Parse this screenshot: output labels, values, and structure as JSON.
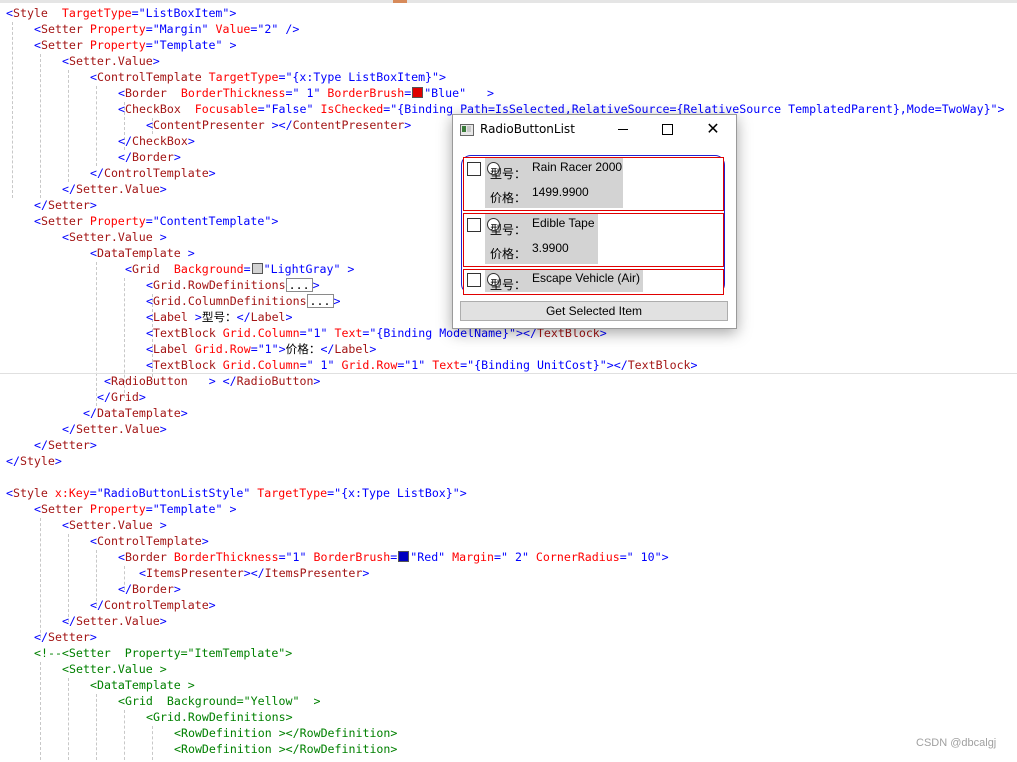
{
  "editor": {
    "lines": [
      [
        {
          "c": "punct",
          "t": "<"
        },
        {
          "c": "tag",
          "t": "Style"
        },
        {
          "c": "attr",
          "t": "  TargetType"
        },
        {
          "c": "punct",
          "t": "="
        },
        {
          "c": "str",
          "t": "\"ListBoxItem\""
        },
        {
          "c": "punct",
          "t": ">"
        }
      ],
      [
        {
          "c": "punct",
          "t": "<"
        },
        {
          "c": "tag",
          "t": "Setter"
        },
        {
          "c": "attr",
          "t": " Property"
        },
        {
          "c": "punct",
          "t": "="
        },
        {
          "c": "str",
          "t": "\"Margin\""
        },
        {
          "c": "attr",
          "t": " Value"
        },
        {
          "c": "punct",
          "t": "="
        },
        {
          "c": "str",
          "t": "\"2\""
        },
        {
          "c": "punct",
          "t": " />"
        }
      ],
      [
        {
          "c": "punct",
          "t": "<"
        },
        {
          "c": "tag",
          "t": "Setter"
        },
        {
          "c": "attr",
          "t": " Property"
        },
        {
          "c": "punct",
          "t": "="
        },
        {
          "c": "str",
          "t": "\"Template\""
        },
        {
          "c": "punct",
          "t": " >"
        }
      ],
      [
        {
          "c": "punct",
          "t": "<"
        },
        {
          "c": "tag",
          "t": "Setter.Value"
        },
        {
          "c": "punct",
          "t": ">"
        }
      ],
      [
        {
          "c": "punct",
          "t": "<"
        },
        {
          "c": "tag",
          "t": "ControlTemplate"
        },
        {
          "c": "attr",
          "t": " TargetType"
        },
        {
          "c": "punct",
          "t": "="
        },
        {
          "c": "str",
          "t": "\"{x:Type ListBoxItem}\""
        },
        {
          "c": "punct",
          "t": ">"
        }
      ],
      [
        {
          "c": "punct",
          "t": "<"
        },
        {
          "c": "tag",
          "t": "Border"
        },
        {
          "c": "attr",
          "t": "  BorderThickness"
        },
        {
          "c": "punct",
          "t": "="
        },
        {
          "c": "str",
          "t": "\" 1\""
        },
        {
          "c": "attr",
          "t": " BorderBrush"
        },
        {
          "c": "punct",
          "t": "="
        },
        {
          "c": "swatch",
          "t": "#e00000"
        },
        {
          "c": "str",
          "t": "\"Blue\""
        },
        {
          "c": "punct",
          "t": "   >"
        }
      ],
      [
        {
          "c": "punct",
          "t": "<"
        },
        {
          "c": "tag",
          "t": "CheckBox"
        },
        {
          "c": "attr",
          "t": "  Focusable"
        },
        {
          "c": "punct",
          "t": "="
        },
        {
          "c": "str",
          "t": "\"False\""
        },
        {
          "c": "attr",
          "t": " IsChecked"
        },
        {
          "c": "punct",
          "t": "="
        },
        {
          "c": "str",
          "t": "\"{Binding Path=IsSelected,RelativeSource={RelativeSource TemplatedParent},Mode=TwoWay}\""
        },
        {
          "c": "punct",
          "t": ">"
        }
      ],
      [
        {
          "c": "punct",
          "t": "<"
        },
        {
          "c": "tag",
          "t": "ContentPresenter"
        },
        {
          "c": "punct",
          "t": " ></"
        },
        {
          "c": "tag",
          "t": "ContentPresenter"
        },
        {
          "c": "punct",
          "t": ">"
        }
      ],
      [
        {
          "c": "punct",
          "t": "</"
        },
        {
          "c": "tag",
          "t": "CheckBox"
        },
        {
          "c": "punct",
          "t": ">"
        }
      ],
      [
        {
          "c": "punct",
          "t": "</"
        },
        {
          "c": "tag",
          "t": "Border"
        },
        {
          "c": "punct",
          "t": ">"
        }
      ],
      [
        {
          "c": "punct",
          "t": "</"
        },
        {
          "c": "tag",
          "t": "ControlTemplate"
        },
        {
          "c": "punct",
          "t": ">"
        }
      ],
      [
        {
          "c": "punct",
          "t": "</"
        },
        {
          "c": "tag",
          "t": "Setter.Value"
        },
        {
          "c": "punct",
          "t": ">"
        }
      ],
      [
        {
          "c": "punct",
          "t": "</"
        },
        {
          "c": "tag",
          "t": "Setter"
        },
        {
          "c": "punct",
          "t": ">"
        }
      ],
      [
        {
          "c": "punct",
          "t": "<"
        },
        {
          "c": "tag",
          "t": "Setter"
        },
        {
          "c": "attr",
          "t": " Property"
        },
        {
          "c": "punct",
          "t": "="
        },
        {
          "c": "str",
          "t": "\"ContentTemplate\""
        },
        {
          "c": "punct",
          "t": ">"
        }
      ],
      [
        {
          "c": "punct",
          "t": "<"
        },
        {
          "c": "tag",
          "t": "Setter.Value"
        },
        {
          "c": "punct",
          "t": " >"
        }
      ],
      [
        {
          "c": "punct",
          "t": "<"
        },
        {
          "c": "tag",
          "t": "DataTemplate"
        },
        {
          "c": "punct",
          "t": " >"
        }
      ],
      [
        {
          "c": "punct",
          "t": "<"
        },
        {
          "c": "tag",
          "t": "Grid"
        },
        {
          "c": "attr",
          "t": "  Background"
        },
        {
          "c": "punct",
          "t": "="
        },
        {
          "c": "swatch",
          "t": "#d3d3d3"
        },
        {
          "c": "str",
          "t": "\"LightGray\""
        },
        {
          "c": "punct",
          "t": " >"
        }
      ],
      [
        {
          "c": "punct",
          "t": "<"
        },
        {
          "c": "tag",
          "t": "Grid.RowDefinitions"
        },
        {
          "c": "box",
          "t": "..."
        },
        {
          "c": "punct",
          "t": ">"
        }
      ],
      [
        {
          "c": "punct",
          "t": "<"
        },
        {
          "c": "tag",
          "t": "Grid.ColumnDefinitions"
        },
        {
          "c": "box",
          "t": "..."
        },
        {
          "c": "punct",
          "t": ">"
        }
      ],
      [
        {
          "c": "punct",
          "t": "<"
        },
        {
          "c": "tag",
          "t": "Label"
        },
        {
          "c": "punct",
          "t": " >"
        },
        {
          "c": "text",
          "t": "型号："
        },
        {
          "c": "punct",
          "t": "</"
        },
        {
          "c": "tag",
          "t": "Label"
        },
        {
          "c": "punct",
          "t": ">"
        }
      ],
      [
        {
          "c": "punct",
          "t": "<"
        },
        {
          "c": "tag",
          "t": "TextBlock"
        },
        {
          "c": "attr",
          "t": " Grid.Column"
        },
        {
          "c": "punct",
          "t": "="
        },
        {
          "c": "str",
          "t": "\"1\""
        },
        {
          "c": "attr",
          "t": " Text"
        },
        {
          "c": "punct",
          "t": "="
        },
        {
          "c": "str",
          "t": "\"{Binding ModelName}\""
        },
        {
          "c": "punct",
          "t": "></"
        },
        {
          "c": "tag",
          "t": "TextBlock"
        },
        {
          "c": "punct",
          "t": ">"
        }
      ],
      [
        {
          "c": "punct",
          "t": "<"
        },
        {
          "c": "tag",
          "t": "Label"
        },
        {
          "c": "attr",
          "t": " Grid.Row"
        },
        {
          "c": "punct",
          "t": "="
        },
        {
          "c": "str",
          "t": "\"1\""
        },
        {
          "c": "punct",
          "t": ">"
        },
        {
          "c": "text",
          "t": "价格："
        },
        {
          "c": "punct",
          "t": "</"
        },
        {
          "c": "tag",
          "t": "Label"
        },
        {
          "c": "punct",
          "t": ">"
        }
      ],
      [
        {
          "c": "punct",
          "t": "<"
        },
        {
          "c": "tag",
          "t": "TextBlock"
        },
        {
          "c": "attr",
          "t": " Grid.Column"
        },
        {
          "c": "punct",
          "t": "="
        },
        {
          "c": "str",
          "t": "\" 1\""
        },
        {
          "c": "attr",
          "t": " Grid.Row"
        },
        {
          "c": "punct",
          "t": "="
        },
        {
          "c": "str",
          "t": "\"1\""
        },
        {
          "c": "attr",
          "t": " Text"
        },
        {
          "c": "punct",
          "t": "="
        },
        {
          "c": "str",
          "t": "\"{Binding UnitCost}\""
        },
        {
          "c": "punct",
          "t": "></"
        },
        {
          "c": "tag",
          "t": "TextBlock"
        },
        {
          "c": "punct",
          "t": ">"
        }
      ],
      [
        {
          "c": "punct",
          "t": "<"
        },
        {
          "c": "tag",
          "t": "RadioButton"
        },
        {
          "c": "punct",
          "t": "   > </"
        },
        {
          "c": "tag",
          "t": "RadioButton"
        },
        {
          "c": "punct",
          "t": ">"
        }
      ],
      [
        {
          "c": "punct",
          "t": "</"
        },
        {
          "c": "tag",
          "t": "Grid"
        },
        {
          "c": "punct",
          "t": ">"
        }
      ],
      [
        {
          "c": "punct",
          "t": "</"
        },
        {
          "c": "tag",
          "t": "DataTemplate"
        },
        {
          "c": "punct",
          "t": ">"
        }
      ],
      [
        {
          "c": "punct",
          "t": "</"
        },
        {
          "c": "tag",
          "t": "Setter.Value"
        },
        {
          "c": "punct",
          "t": ">"
        }
      ],
      [
        {
          "c": "punct",
          "t": "</"
        },
        {
          "c": "tag",
          "t": "Setter"
        },
        {
          "c": "punct",
          "t": ">"
        }
      ],
      [
        {
          "c": "punct",
          "t": "</"
        },
        {
          "c": "tag",
          "t": "Style"
        },
        {
          "c": "punct",
          "t": ">"
        }
      ],
      [],
      [
        {
          "c": "punct",
          "t": "<"
        },
        {
          "c": "tag",
          "t": "Style"
        },
        {
          "c": "attr",
          "t": " x:Key"
        },
        {
          "c": "punct",
          "t": "="
        },
        {
          "c": "str",
          "t": "\"RadioButtonListStyle\""
        },
        {
          "c": "attr",
          "t": " TargetType"
        },
        {
          "c": "punct",
          "t": "="
        },
        {
          "c": "str",
          "t": "\"{x:Type ListBox}\""
        },
        {
          "c": "punct",
          "t": ">"
        }
      ],
      [
        {
          "c": "punct",
          "t": "<"
        },
        {
          "c": "tag",
          "t": "Setter"
        },
        {
          "c": "attr",
          "t": " Property"
        },
        {
          "c": "punct",
          "t": "="
        },
        {
          "c": "str",
          "t": "\"Template\""
        },
        {
          "c": "punct",
          "t": " >"
        }
      ],
      [
        {
          "c": "punct",
          "t": "<"
        },
        {
          "c": "tag",
          "t": "Setter.Value"
        },
        {
          "c": "punct",
          "t": " >"
        }
      ],
      [
        {
          "c": "punct",
          "t": "<"
        },
        {
          "c": "tag",
          "t": "ControlTemplate"
        },
        {
          "c": "punct",
          "t": ">"
        }
      ],
      [
        {
          "c": "punct",
          "t": "<"
        },
        {
          "c": "tag",
          "t": "Border"
        },
        {
          "c": "attr",
          "t": " BorderThickness"
        },
        {
          "c": "punct",
          "t": "="
        },
        {
          "c": "str",
          "t": "\"1\""
        },
        {
          "c": "attr",
          "t": " BorderBrush"
        },
        {
          "c": "punct",
          "t": "="
        },
        {
          "c": "swatch",
          "t": "#0000c0"
        },
        {
          "c": "str",
          "t": "\"Red\""
        },
        {
          "c": "attr",
          "t": " Margin"
        },
        {
          "c": "punct",
          "t": "="
        },
        {
          "c": "str",
          "t": "\" 2\""
        },
        {
          "c": "attr",
          "t": " CornerRadius"
        },
        {
          "c": "punct",
          "t": "="
        },
        {
          "c": "str",
          "t": "\" 10\""
        },
        {
          "c": "punct",
          "t": ">"
        }
      ],
      [
        {
          "c": "punct",
          "t": "<"
        },
        {
          "c": "tag",
          "t": "ItemsPresenter"
        },
        {
          "c": "punct",
          "t": "></"
        },
        {
          "c": "tag",
          "t": "ItemsPresenter"
        },
        {
          "c": "punct",
          "t": ">"
        }
      ],
      [
        {
          "c": "punct",
          "t": "</"
        },
        {
          "c": "tag",
          "t": "Border"
        },
        {
          "c": "punct",
          "t": ">"
        }
      ],
      [
        {
          "c": "punct",
          "t": "</"
        },
        {
          "c": "tag",
          "t": "ControlTemplate"
        },
        {
          "c": "punct",
          "t": ">"
        }
      ],
      [
        {
          "c": "punct",
          "t": "</"
        },
        {
          "c": "tag",
          "t": "Setter.Value"
        },
        {
          "c": "punct",
          "t": ">"
        }
      ],
      [
        {
          "c": "punct",
          "t": "</"
        },
        {
          "c": "tag",
          "t": "Setter"
        },
        {
          "c": "punct",
          "t": ">"
        }
      ],
      [
        {
          "c": "comment",
          "t": "<!--<Setter  Property=\"ItemTemplate\">"
        }
      ],
      [
        {
          "c": "comment",
          "t": "<Setter.Value >"
        }
      ],
      [
        {
          "c": "comment",
          "t": "<DataTemplate >"
        }
      ],
      [
        {
          "c": "comment",
          "t": "<Grid  Background=\"Yellow\"  >"
        }
      ],
      [
        {
          "c": "comment",
          "t": "<Grid.RowDefinitions>"
        }
      ],
      [
        {
          "c": "comment",
          "t": "<RowDefinition ></RowDefinition>"
        }
      ],
      [
        {
          "c": "comment",
          "t": "<RowDefinition ></RowDefinition>"
        }
      ]
    ]
  },
  "window": {
    "title": "RadioButtonList",
    "label_model": "型号：",
    "label_price": "价格：",
    "items": [
      {
        "model": "Rain Racer 2000",
        "price": "1499.9900"
      },
      {
        "model": "Edible Tape",
        "price": "3.9900"
      },
      {
        "model": "Escape Vehicle (Air)",
        "price": ""
      }
    ],
    "button_label": "Get Selected Item"
  },
  "watermark": "CSDN @dbcalgj",
  "colors": {
    "item_border": "#e00000",
    "list_border": "#2020d0",
    "grid_background": "#d3d3d3",
    "xml_tag": "#a31515",
    "xml_attribute": "#ff0000",
    "xml_value": "#0000ff",
    "xml_comment": "#008000"
  }
}
